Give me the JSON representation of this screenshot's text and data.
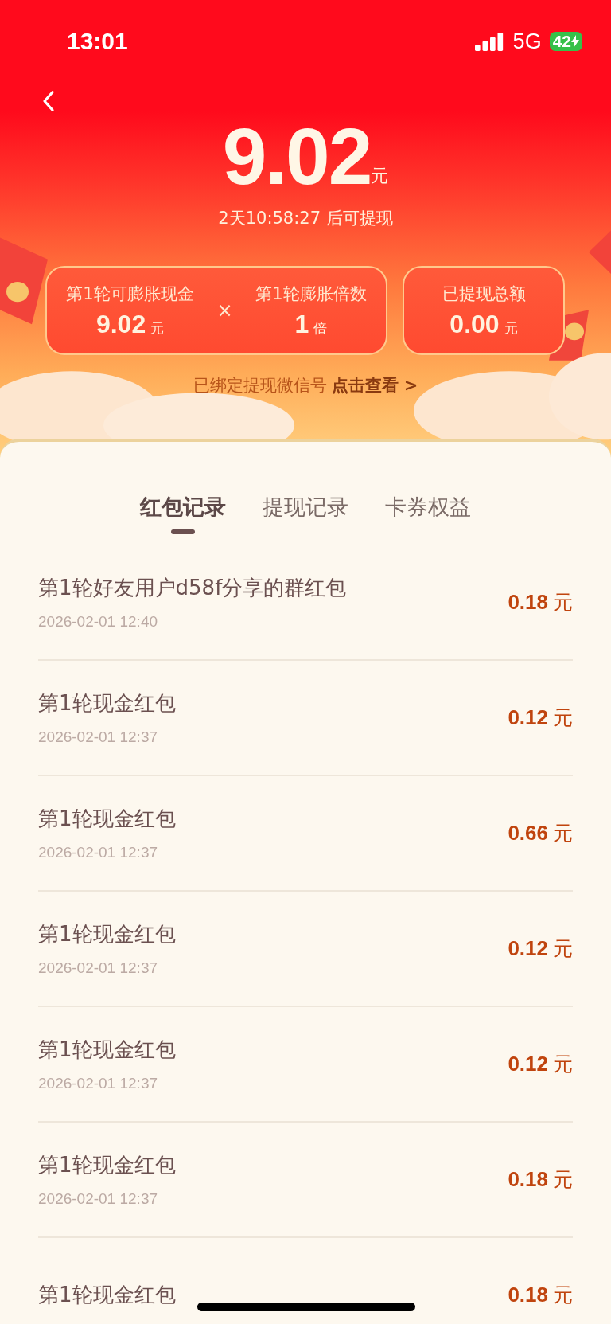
{
  "status_bar": {
    "time": "13:01",
    "network": "5G",
    "battery": "42"
  },
  "header": {
    "amount": "9.02",
    "unit": "元",
    "countdown": "2天10:58:27 后可提现"
  },
  "cards": [
    {
      "kind": "multiply",
      "left": {
        "label": "第1轮可膨胀现金",
        "value": "9.02",
        "unit": "元"
      },
      "operator": "×",
      "right": {
        "label": "第1轮膨胀倍数",
        "value": "1",
        "unit": "倍"
      }
    },
    {
      "kind": "single",
      "label": "已提现总额",
      "value": "0.00",
      "unit": "元"
    }
  ],
  "wechat": {
    "text": "已绑定提现微信号",
    "link": "点击查看 >"
  },
  "tabs": [
    {
      "label": "红包记录",
      "selected": true
    },
    {
      "label": "提现记录",
      "selected": false
    },
    {
      "label": "卡券权益",
      "selected": false
    }
  ],
  "records": [
    {
      "title": "第1轮好友用户d58f分享的群红包",
      "date": "2026-02-01 12:40",
      "amount": "0.18",
      "unit": "元"
    },
    {
      "title": "第1轮现金红包",
      "date": "2026-02-01 12:37",
      "amount": "0.12",
      "unit": "元"
    },
    {
      "title": "第1轮现金红包",
      "date": "2026-02-01 12:37",
      "amount": "0.66",
      "unit": "元"
    },
    {
      "title": "第1轮现金红包",
      "date": "2026-02-01 12:37",
      "amount": "0.12",
      "unit": "元"
    },
    {
      "title": "第1轮现金红包",
      "date": "2026-02-01 12:37",
      "amount": "0.12",
      "unit": "元"
    },
    {
      "title": "第1轮现金红包",
      "date": "2026-02-01 12:37",
      "amount": "0.18",
      "unit": "元"
    },
    {
      "title": "第1轮现金红包",
      "amount": "0.18",
      "unit": "元"
    }
  ]
}
